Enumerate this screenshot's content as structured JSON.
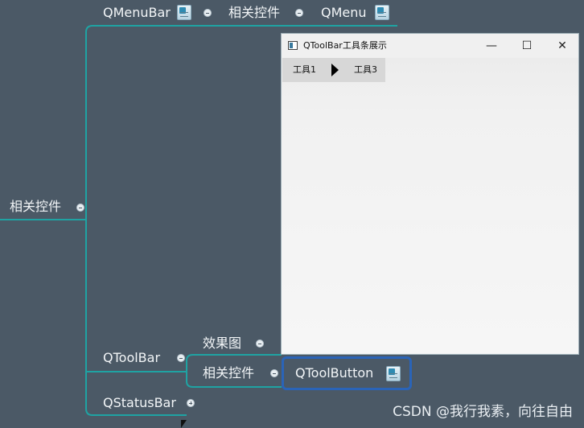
{
  "mindmap": {
    "root": {
      "label": "相关控件"
    },
    "menubar": {
      "label": "QMenuBar",
      "related_label": "相关控件",
      "menu_label": "QMenu"
    },
    "toolbar": {
      "label": "QToolBar",
      "effect_label": "效果图",
      "related_label": "相关控件",
      "toolbutton_label": "QToolButton"
    },
    "statusbar": {
      "label": "QStatusBar"
    }
  },
  "window": {
    "title": "QToolBar工具条展示",
    "minimize": "—",
    "maximize": "☐",
    "close": "✕",
    "tools": [
      "工具1",
      "工具3"
    ]
  },
  "watermark": "CSDN @我行我素，向往自由",
  "colors": {
    "background": "#4b5966",
    "line": "#1fa3a3",
    "selection": "#2a64b8"
  },
  "icons": [
    "collapse-toggle-icon",
    "expand-toggle-icon",
    "document-icon",
    "play-arrow-icon",
    "app-window-icon"
  ]
}
